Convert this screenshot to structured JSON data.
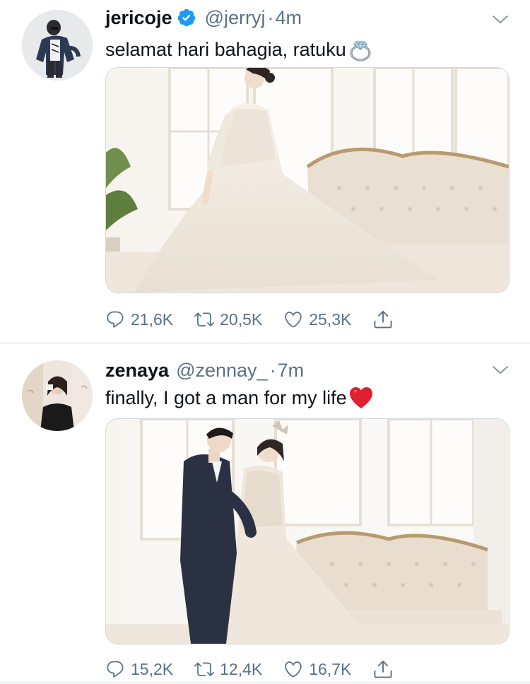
{
  "tweets": [
    {
      "display_name": "jericoje",
      "verified": true,
      "handle": "@jerryj",
      "separator": "·",
      "time": "4m",
      "text": "selamat hari bahagia, ratuku",
      "emoji": "ring-emoji",
      "media": "photo of bride in white gown seated on tufted sofa",
      "stats": {
        "replies": "21,6K",
        "retweets": "20,5K",
        "likes": "25,3K"
      }
    },
    {
      "display_name": "zenaya",
      "verified": false,
      "handle": "@zennay_",
      "separator": "·",
      "time": "7m",
      "text": "finally, I got a man for my life",
      "emoji": "red-heart-emoji",
      "media": "photo of groom in suit and bride in gown embracing by sofa",
      "stats": {
        "replies": "15,2K",
        "retweets": "12,4K",
        "likes": "16,7K"
      }
    }
  ],
  "icons": {
    "reply": "speech-bubble-icon",
    "retweet": "retweet-arrows-icon",
    "like": "heart-outline-icon",
    "share": "share-upload-icon",
    "more": "chevron-down-icon",
    "verified": "verified-badge-icon"
  },
  "colors": {
    "text": "#0f1419",
    "secondary": "#5b7083",
    "verified": "#1d9bf0",
    "divider": "#d5d9dc",
    "heart_emoji": "#e0202f"
  }
}
